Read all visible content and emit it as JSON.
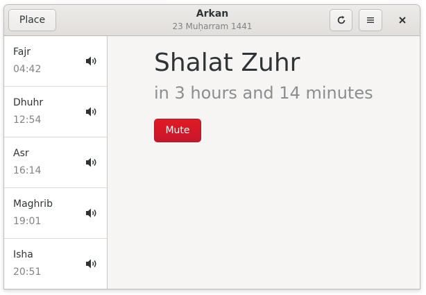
{
  "header": {
    "place_label": "Place",
    "title": "Arkan",
    "subtitle": "23 Muḥarram 1441",
    "reload_icon": "reload-icon",
    "menu_icon": "hamburger-menu-icon",
    "close_icon": "close-icon"
  },
  "prayers": [
    {
      "name": "Fajr",
      "time": "04:42",
      "icon": "speaker-icon"
    },
    {
      "name": "Dhuhr",
      "time": "12:54",
      "icon": "speaker-icon"
    },
    {
      "name": "Asr",
      "time": "16:14",
      "icon": "speaker-icon"
    },
    {
      "name": "Maghrib",
      "time": "19:01",
      "icon": "speaker-icon"
    },
    {
      "name": "Isha",
      "time": "20:51",
      "icon": "speaker-icon"
    }
  ],
  "main": {
    "headline": "Shalat Zuhr",
    "countdown": "in 3 hours and 14 minutes",
    "mute_label": "Mute"
  },
  "colors": {
    "accent_destructive": "#e01b24",
    "text": "#2e3436",
    "dim_text": "#7f8384"
  }
}
